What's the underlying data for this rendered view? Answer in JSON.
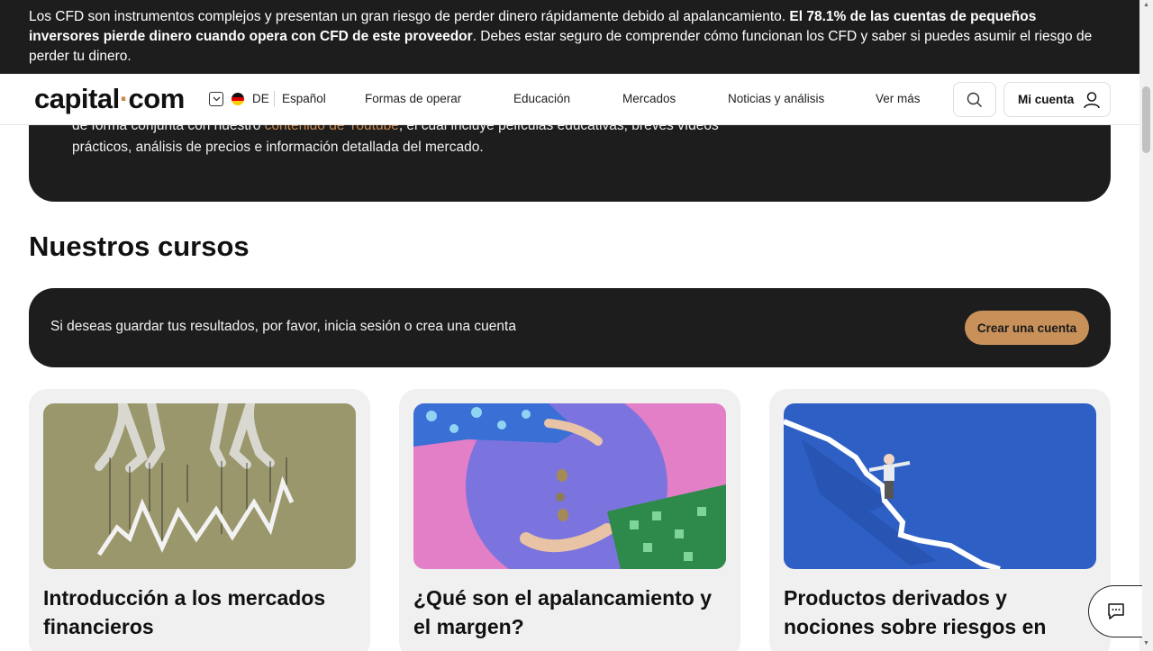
{
  "risk_banner": {
    "text_start": "Los CFD son instrumentos complejos y presentan un gran riesgo de perder dinero rápidamente debido al apalancamiento. ",
    "text_bold": "El 78.1% de las cuentas de pequeños inversores pierde dinero cuando opera con CFD de este proveedor",
    "text_end": ". Debes estar seguro de comprender cómo funcionan los CFD y saber si puedes asumir el riesgo de perder tu dinero."
  },
  "header": {
    "logo_left": "capital",
    "logo_dot": "·",
    "logo_right": "com",
    "lang_code": "DE",
    "lang_name": "Español",
    "nav": [
      {
        "label": "Formas de operar"
      },
      {
        "label": "Educación"
      },
      {
        "label": "Mercados"
      },
      {
        "label": "Noticias y análisis"
      },
      {
        "label": "Ver más"
      }
    ],
    "account_label": "Mi cuenta"
  },
  "intro": {
    "text_start": "de forma conjunta con nuestro ",
    "link": "contenido de Youtube",
    "text_end": ", el cual incluye películas educativas, breves vídeos prácticos, análisis de precios e información detallada del mercado."
  },
  "courses_section": {
    "title": "Nuestros cursos",
    "login_prompt": "Si deseas guardar tus resultados, por favor, inicia sesión o crea una cuenta",
    "create_account": "Crear una cuenta",
    "courses": [
      {
        "title": "Introducción a los mercados financieros"
      },
      {
        "title": "¿Qué son el apalancamiento y el margen?"
      },
      {
        "title": "Productos derivados y nociones sobre riesgos en"
      }
    ]
  },
  "colors": {
    "dark": "#1d1d1d",
    "accent": "#c88a4e",
    "button": "#c9915a"
  },
  "icons": [
    "chevron-down-icon",
    "germany-flag-icon",
    "search-icon",
    "user-icon",
    "chat-icon"
  ]
}
